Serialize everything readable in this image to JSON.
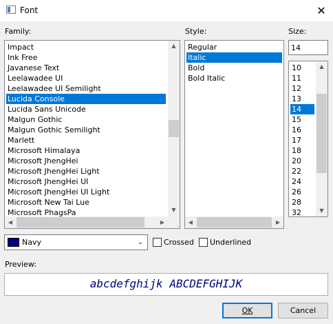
{
  "window": {
    "title": "Font",
    "close_glyph": "✕"
  },
  "family": {
    "label": "Family:",
    "items": [
      "Impact",
      "Ink Free",
      "Javanese Text",
      "Leelawadee UI",
      "Leelawadee UI Semilight",
      "Lucida Console",
      "Lucida Sans Unicode",
      "Malgun Gothic",
      "Malgun Gothic Semilight",
      "Marlett",
      "Microsoft Himalaya",
      "Microsoft JhengHei",
      "Microsoft JhengHei Light",
      "Microsoft JhengHei UI",
      "Microsoft JhengHei UI Light",
      "Microsoft New Tai Lue",
      "Microsoft PhagsPa"
    ],
    "selected": "Lucida Console"
  },
  "style": {
    "label": "Style:",
    "items": [
      "Regular",
      "Italic",
      "Bold",
      "Bold Italic"
    ],
    "selected": "Italic"
  },
  "size": {
    "label": "Size:",
    "value": "14",
    "items": [
      "10",
      "11",
      "12",
      "13",
      "14",
      "15",
      "16",
      "17",
      "18",
      "20",
      "22",
      "24",
      "26",
      "28",
      "32"
    ],
    "selected": "14"
  },
  "color": {
    "selected": "Navy",
    "swatch": "#000080"
  },
  "effects": {
    "crossed_label": "Crossed",
    "underlined_label": "Underlined"
  },
  "preview": {
    "label": "Preview:",
    "sample": "abcdefghijk ABCDEFGHIJK",
    "color": "#000080"
  },
  "buttons": {
    "ok": "OK",
    "cancel": "Cancel"
  },
  "colors": {
    "selection": "#0078d7",
    "window": "#f0f0f0"
  }
}
